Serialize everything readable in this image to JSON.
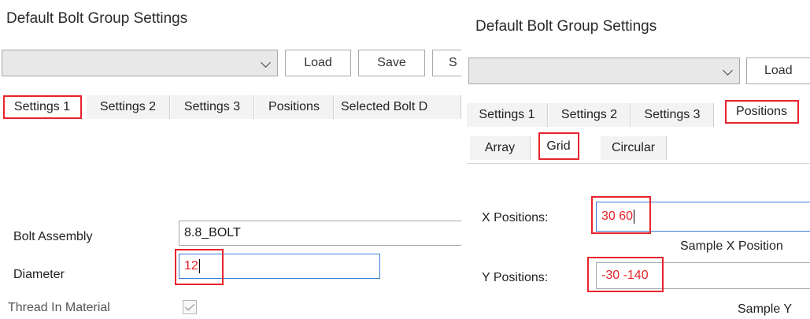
{
  "left": {
    "title": "Default Bolt Group Settings",
    "toolbar": {
      "load_label": "Load",
      "save_label": "Save",
      "next_label": "S"
    },
    "tabs": [
      {
        "label": "Settings 1",
        "active": true,
        "highlighted": true
      },
      {
        "label": "Settings 2"
      },
      {
        "label": "Settings 3"
      },
      {
        "label": "Positions"
      },
      {
        "label": "Selected Bolt D"
      }
    ],
    "fields": {
      "bolt_assembly": {
        "label": "Bolt Assembly",
        "value": "8.8_BOLT"
      },
      "diameter": {
        "label": "Diameter",
        "value": "12"
      },
      "thread_in_material": {
        "label": "Thread In Material",
        "checked": true
      }
    }
  },
  "right": {
    "title": "Default Bolt Group Settings",
    "toolbar": {
      "load_label": "Load"
    },
    "tabs": [
      {
        "label": "Settings 1"
      },
      {
        "label": "Settings 2"
      },
      {
        "label": "Settings 3"
      },
      {
        "label": "Positions",
        "active": true,
        "highlighted": true
      }
    ],
    "subtabs": [
      {
        "label": "Array"
      },
      {
        "label": "Grid",
        "active": true,
        "highlighted": true
      },
      {
        "label": "Circular"
      }
    ],
    "fields": {
      "x_positions": {
        "label": "X Positions:",
        "value": "30 60",
        "sample": "Sample X Position"
      },
      "y_positions": {
        "label": "Y Positions:",
        "value": "-30 -140",
        "sample": "Sample Y"
      }
    }
  },
  "colors": {
    "highlight": "#e8242c",
    "focus_border": "#3a7fd5",
    "value_text": "#e8242c"
  }
}
